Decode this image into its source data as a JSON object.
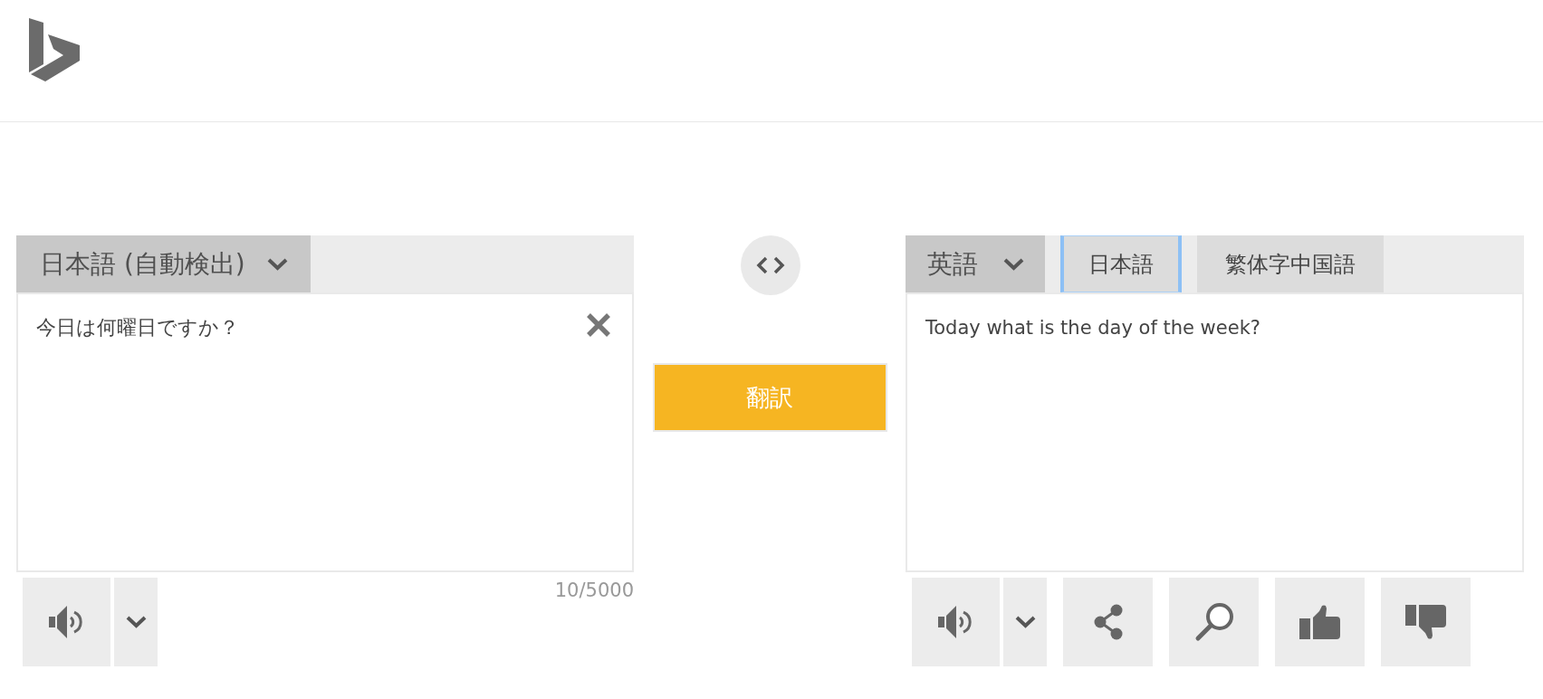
{
  "source": {
    "language": "日本語 (自動検出)",
    "text": "今日は何曜日ですか？",
    "char_count": "10/5000",
    "actions": [
      {
        "kind": "speak"
      },
      {
        "kind": "menu"
      }
    ]
  },
  "translate_button": {
    "label": "翻訳"
  },
  "target": {
    "language": "英語",
    "quick_languages": [
      {
        "label": "日本語",
        "focused": true
      },
      {
        "label": "繁体字中国語",
        "focused": false
      }
    ],
    "text": "Today what is the day of the week?",
    "actions": [
      {
        "kind": "speak"
      },
      {
        "kind": "menu"
      },
      {
        "kind": "share"
      },
      {
        "kind": "search"
      },
      {
        "kind": "like"
      },
      {
        "kind": "dislike"
      }
    ]
  }
}
